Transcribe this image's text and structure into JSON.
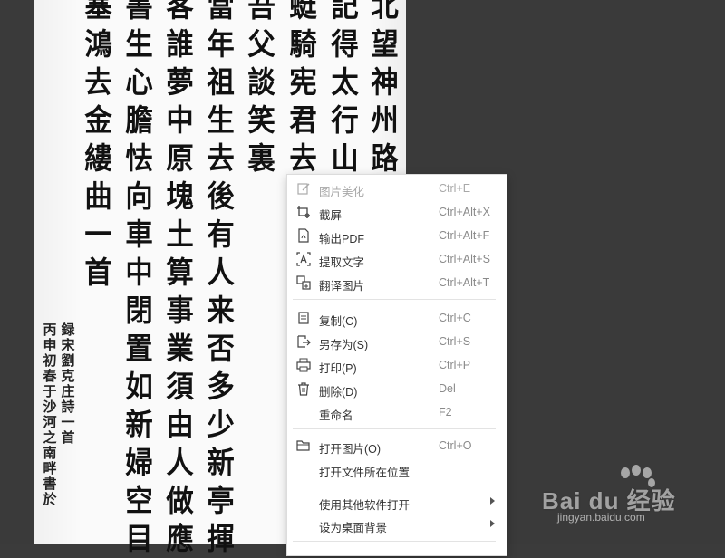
{
  "calligraphy": {
    "columns": [
      "北望神州路",
      "記得太行山",
      "蜓騎宪君去",
      "吾父談笑裏",
      "當年祖生去後有人来否多少新亭揮",
      "客誰夢中原塊土算事業須由人做應",
      "書生心膽怯向車中閉置如新婦空目",
      "塞鴻去金縷曲一首"
    ],
    "inscription_columns": [
      "録宋劉克庄詩一首",
      "丙申初春于沙河之南畔書於"
    ]
  },
  "menu": {
    "items": [
      {
        "label": "图片美化",
        "shortcut": "Ctrl+E",
        "icon": "edit-icon",
        "disabled": true
      },
      {
        "label": "截屏",
        "shortcut": "Ctrl+Alt+X",
        "icon": "screenshot-icon"
      },
      {
        "label": "输出PDF",
        "shortcut": "Ctrl+Alt+F",
        "icon": "pdf-icon"
      },
      {
        "label": "提取文字",
        "shortcut": "Ctrl+Alt+S",
        "icon": "text-extract-icon"
      },
      {
        "label": "翻译图片",
        "shortcut": "Ctrl+Alt+T",
        "icon": "translate-icon"
      },
      {
        "label": "复制(C)",
        "shortcut": "Ctrl+C",
        "icon": "copy-icon"
      },
      {
        "label": "另存为(S)",
        "shortcut": "Ctrl+S",
        "icon": "save-as-icon"
      },
      {
        "label": "打印(P)",
        "shortcut": "Ctrl+P",
        "icon": "print-icon"
      },
      {
        "label": "删除(D)",
        "shortcut": "Del",
        "icon": "trash-icon"
      },
      {
        "label": "重命名",
        "shortcut": "F2",
        "icon": ""
      },
      {
        "label": "打开图片(O)",
        "shortcut": "Ctrl+O",
        "icon": "folder-icon"
      },
      {
        "label": "打开文件所在位置",
        "shortcut": "",
        "icon": ""
      },
      {
        "label": "使用其他软件打开",
        "shortcut": "",
        "icon": "",
        "submenu": true
      },
      {
        "label": "设为桌面背景",
        "shortcut": "",
        "icon": "",
        "submenu": true
      }
    ]
  },
  "watermark": {
    "brand": "Bai du 经验",
    "site": "jingyan.baidu.com"
  }
}
